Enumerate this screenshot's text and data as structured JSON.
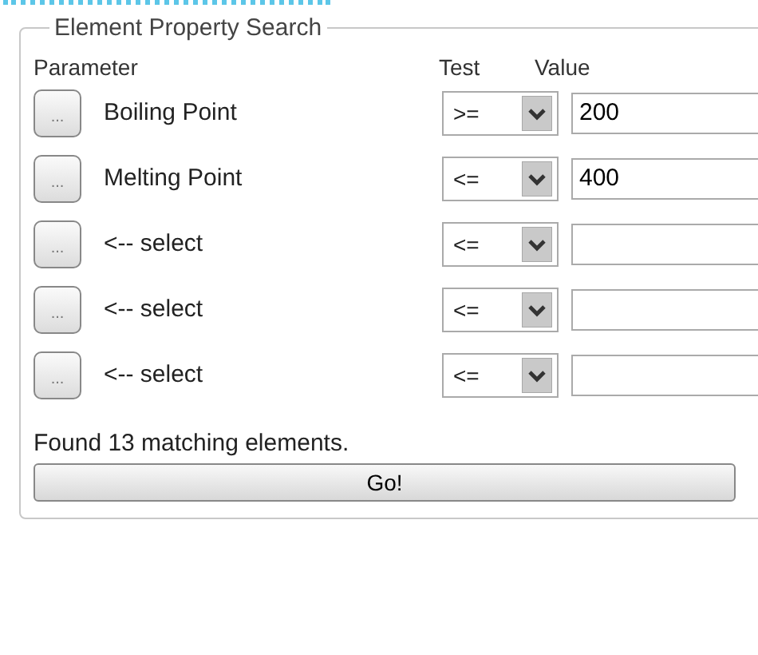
{
  "group": {
    "title": "Element Property Search"
  },
  "columns": [
    "Parameter",
    "Test",
    "Value"
  ],
  "rows": [
    {
      "button": "...",
      "parameter": "Boiling Point",
      "test": ">=",
      "value": "200"
    },
    {
      "button": "...",
      "parameter": "Melting Point",
      "test": "<=",
      "value": "400"
    },
    {
      "button": "...",
      "parameter": "<-- select",
      "test": "<=",
      "value": ""
    },
    {
      "button": "...",
      "parameter": "<-- select",
      "test": "<=",
      "value": ""
    },
    {
      "button": "...",
      "parameter": "<-- select",
      "test": "<=",
      "value": ""
    }
  ],
  "status": "Found 13 matching elements.",
  "go_button": "Go!"
}
